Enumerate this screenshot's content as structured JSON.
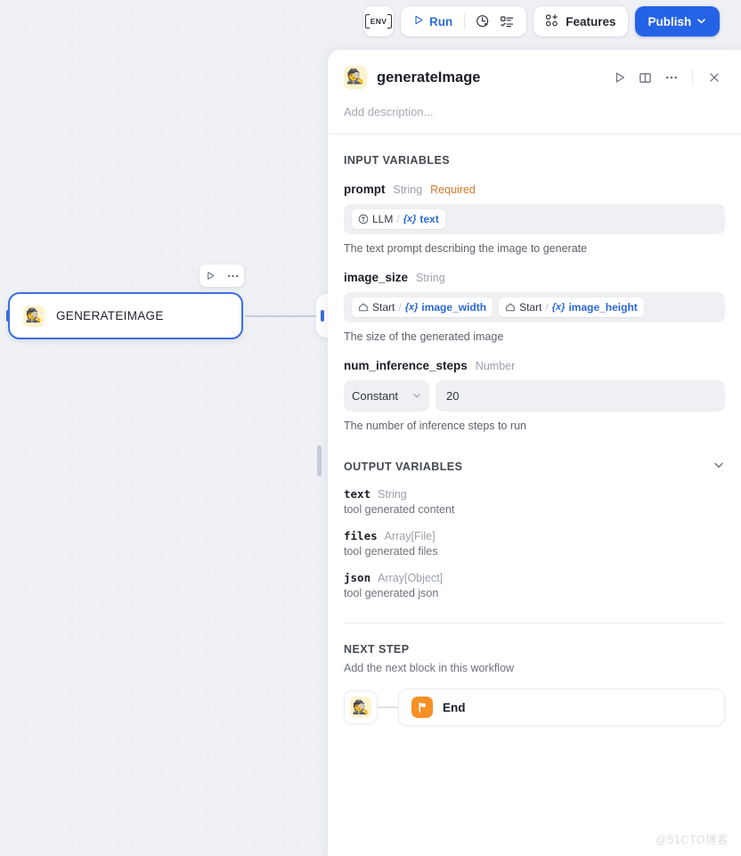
{
  "toolbar": {
    "env_label": "ENV",
    "run_label": "Run",
    "history_icon": "clock-run-icon",
    "checklist_icon": "checklist-icon",
    "features_label": "Features",
    "features_icon": "features-dots-icon",
    "publish_label": "Publish",
    "publish_color": "#2563e6"
  },
  "canvas": {
    "node_label": "GENERATEIMAGE",
    "node_emoji": "🕵️",
    "node_border_color": "#3b6fe0",
    "play_icon": "play-icon",
    "more_icon": "more-horizontal-icon"
  },
  "panel": {
    "emoji": "🕵️",
    "title": "generateImage",
    "description_placeholder": "Add description...",
    "actions": {
      "run_icon": "play-icon",
      "panel_icon": "split-panel-icon",
      "more_icon": "more-horizontal-icon",
      "close_icon": "close-icon"
    },
    "input_section": {
      "heading": "INPUT VARIABLES",
      "variables": [
        {
          "name": "prompt",
          "type": "String",
          "required_label": "Required",
          "description": "The text prompt describing the image to generate",
          "control": "chips",
          "chips": [
            {
              "icon": "llm-circle-icon",
              "source": "LLM",
              "var_prefix": "{x}",
              "var_name": "text"
            }
          ]
        },
        {
          "name": "image_size",
          "type": "String",
          "required_label": "",
          "description": "The size of the generated image",
          "control": "chips",
          "chips": [
            {
              "icon": "home-icon",
              "source": "Start",
              "var_prefix": "{x}",
              "var_name": "image_width"
            },
            {
              "icon": "home-icon",
              "source": "Start",
              "var_prefix": "{x}",
              "var_name": "image_height"
            }
          ]
        },
        {
          "name": "num_inference_steps",
          "type": "Number",
          "required_label": "",
          "description": "The number of inference steps to run",
          "control": "constant",
          "mode_label": "Constant",
          "value": "20"
        }
      ]
    },
    "output_section": {
      "heading": "OUTPUT VARIABLES",
      "collapse_icon": "chevron-down-icon",
      "variables": [
        {
          "name": "text",
          "type": "String",
          "description": "tool generated content"
        },
        {
          "name": "files",
          "type": "Array[File]",
          "description": "tool generated files"
        },
        {
          "name": "json",
          "type": "Array[Object]",
          "description": "tool generated json"
        }
      ]
    },
    "next_section": {
      "heading": "NEXT STEP",
      "description": "Add the next block in this workflow",
      "source_emoji": "🕵️",
      "target_label": "End",
      "target_icon": "flag-icon",
      "target_icon_color": "#f59025"
    }
  },
  "watermark": "@51CTO博客"
}
